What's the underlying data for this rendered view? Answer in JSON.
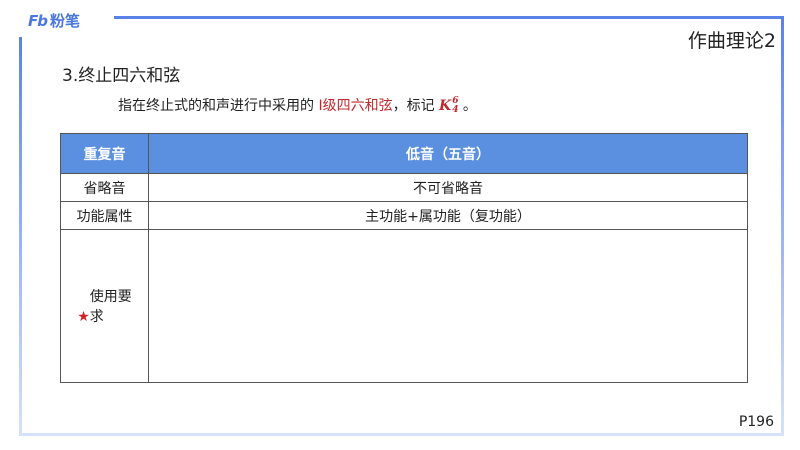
{
  "logo": {
    "mark": "Fb",
    "text": "粉笔"
  },
  "course_title": "作曲理论2",
  "heading": "3.终止四六和弦",
  "description": {
    "prefix": "指在终止式的和声进行中采用的 ",
    "highlight": "Ⅰ级四六和弦",
    "middle": "，标记 ",
    "symbol": "K",
    "sup": "6",
    "sub": "4",
    "suffix": " 。"
  },
  "table": {
    "headers": [
      "重复音",
      "低音（五音）"
    ],
    "rows": [
      {
        "label": "省略音",
        "value": "不可省略音"
      },
      {
        "label": "功能属性",
        "value": "主功能+属功能（复功能）"
      }
    ],
    "usage": {
      "star": "★",
      "label": "使用要求",
      "value": ""
    }
  },
  "page_number": "P196",
  "colors": {
    "accent": "#5b82e8",
    "header": "#5b8fe0",
    "highlight": "#c0282d"
  }
}
